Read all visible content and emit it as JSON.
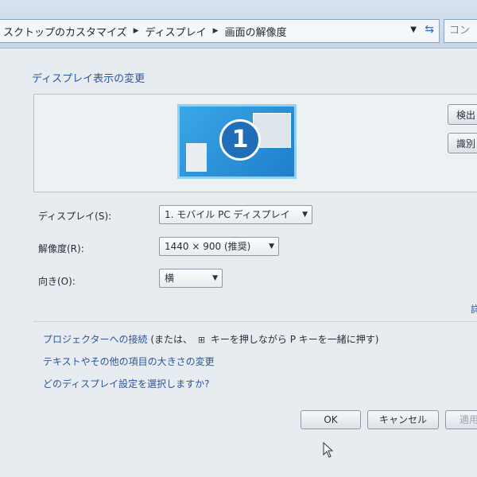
{
  "addressbar": {
    "crumbs": [
      "スクトップのカスタマイズ",
      "ディスプレイ",
      "画面の解像度"
    ],
    "search_placeholder": "コン"
  },
  "section_title": "ディスプレイ表示の変更",
  "side_buttons": {
    "detect": "検出",
    "identify": "識別"
  },
  "display_number": "1",
  "fields": {
    "display": {
      "label": "ディスプレイ(S):",
      "value": "1. モバイル PC ディスプレイ"
    },
    "resolution": {
      "label": "解像度(R):",
      "value": "1440 × 900 (推奨)"
    },
    "orientation": {
      "label": "向き(O):",
      "value": "横"
    }
  },
  "advanced_link_fragment": "詳",
  "links": {
    "projector": "プロジェクターへの接続",
    "projector_suffix_1": "(または、",
    "projector_suffix_2": "キーを押しながら P キーを一緒に押す)",
    "text_size": "テキストやその他の項目の大きさの変更",
    "which_setting": "どのディスプレイ設定を選択しますか?"
  },
  "buttons": {
    "ok": "OK",
    "cancel": "キャンセル",
    "apply": "適用"
  },
  "icons": {
    "refresh": "refresh-icon",
    "windows_key": "windows-logo-icon",
    "cursor": "mouse-pointer-icon"
  }
}
